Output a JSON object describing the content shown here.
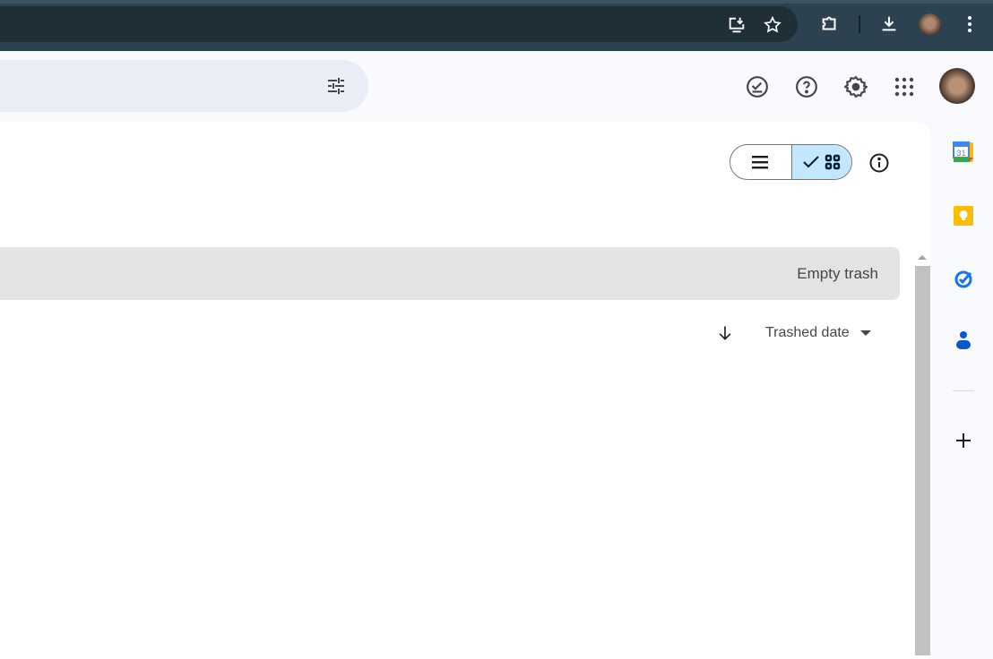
{
  "browser": {
    "icons": [
      "install-app-icon",
      "bookmark-star-icon",
      "extensions-icon",
      "downloads-icon",
      "profile-avatar",
      "more-menu-icon"
    ]
  },
  "header": {
    "icons": [
      "search-options-icon",
      "ready-for-offline-icon",
      "help-icon",
      "settings-icon",
      "apps-grid-icon",
      "account-avatar"
    ]
  },
  "toolbar": {
    "view_list": "list-view",
    "view_grid": "grid-view",
    "selected": "grid",
    "info": "info-icon"
  },
  "trash": {
    "empty_label": "Empty trash"
  },
  "sort": {
    "label": "Trashed date",
    "direction": "descending"
  },
  "side_panel": {
    "apps": [
      "calendar",
      "keep",
      "tasks",
      "contacts"
    ],
    "calendar_day": "31",
    "add": "add-icon"
  },
  "colors": {
    "chrome": "#2c4250",
    "selected_toggle": "#c2e7ff",
    "trash_bar": "#e3e3e3"
  }
}
